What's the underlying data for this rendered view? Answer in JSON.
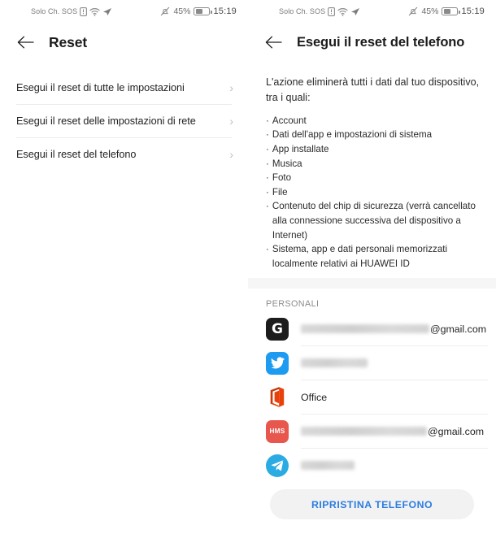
{
  "statusbar": {
    "carrier": "Solo Ch. SOS",
    "sim_icon": "sim-card-icon",
    "wifi_icon": "wifi-icon",
    "location_icon": "location-arrow-icon",
    "mute_icon": "ringer-muted-icon",
    "battery_percent": "45%",
    "battery_icon": "battery-icon",
    "time": "15:19"
  },
  "left_screen": {
    "back_icon": "back-arrow-icon",
    "title": "Reset",
    "items": [
      {
        "label": "Esegui il reset di tutte le impostazioni",
        "chevron": "›"
      },
      {
        "label": "Esegui il reset delle impostazioni di rete",
        "chevron": "›"
      },
      {
        "label": "Esegui il reset del telefono",
        "chevron": "›"
      }
    ]
  },
  "right_screen": {
    "back_icon": "back-arrow-icon",
    "title": "Esegui il reset del telefono",
    "description": "L'azione eliminerà tutti i dati dal tuo dispositivo, tra i quali:",
    "bullet_marker": "·",
    "bullets": [
      "Account",
      "Dati dell'app e impostazioni di sistema",
      "App installate",
      "Musica",
      "Foto",
      "File",
      "Contenuto del chip di sicurezza (verrà cancellato alla connessione successiva del dispositivo a Internet)",
      "Sistema, app e dati personali memorizzati localmente relativi ai HUAWEI ID"
    ],
    "section_header": "PERSONALI",
    "accounts": [
      {
        "icon": "google-icon",
        "icon_label": "G",
        "redacted_width": 158,
        "suffix": "@gmail.com"
      },
      {
        "icon": "twitter-icon",
        "icon_label": "",
        "redacted_width": 82,
        "suffix": ""
      },
      {
        "icon": "office-icon",
        "icon_label": "",
        "redacted_width": 0,
        "suffix": "Office"
      },
      {
        "icon": "hms-icon",
        "icon_label": "HMS",
        "redacted_width": 155,
        "suffix": "@gmail.com"
      },
      {
        "icon": "telegram-icon",
        "icon_label": "",
        "redacted_width": 66,
        "suffix": ""
      }
    ],
    "reset_button_label": "RIPRISTINA TELEFONO"
  },
  "colors": {
    "accent_blue": "#2b7de0",
    "google_bg": "#1c1c1c",
    "twitter_bg": "#1d9bf0",
    "office_orange": "#e8420c",
    "hms_red": "#e8574d",
    "telegram_blue": "#2aabe2",
    "divider": "#ececec",
    "section_band": "#f6f6f6"
  }
}
